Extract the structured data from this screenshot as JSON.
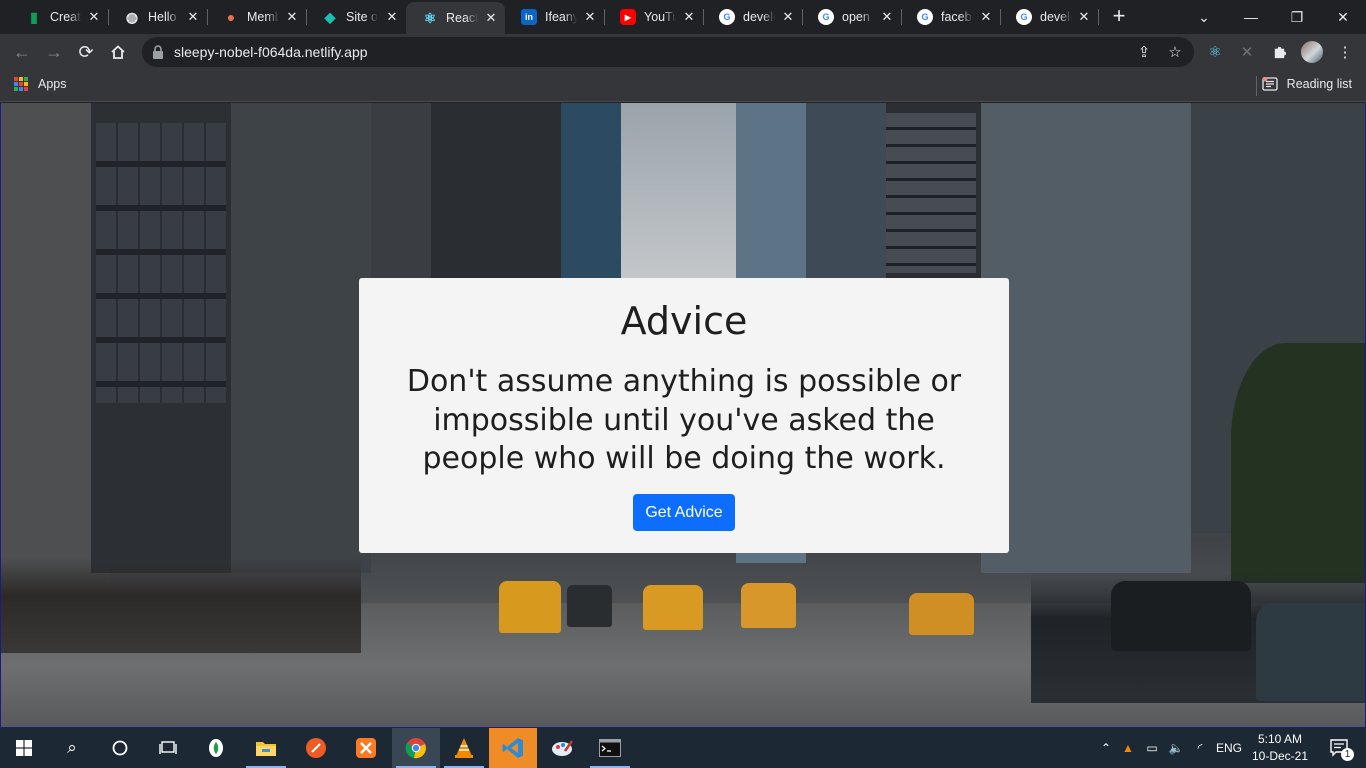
{
  "browser": {
    "tabs": [
      {
        "title": "Creatin",
        "icon": "sheets-icon",
        "color": "#0f9d58"
      },
      {
        "title": "Hello W",
        "icon": "globe-icon",
        "color": "#e8eaed"
      },
      {
        "title": "Memb",
        "icon": "member-icon",
        "color": "#e8744f"
      },
      {
        "title": "Site ov",
        "icon": "netlify-icon",
        "color": "#1bbfb4"
      },
      {
        "title": "React A",
        "icon": "react-icon",
        "color": "#61dafb",
        "active": true
      },
      {
        "title": "Ifeanyi",
        "icon": "linkedin-icon",
        "color": "#0a66c2"
      },
      {
        "title": "YouTub",
        "icon": "youtube-icon",
        "color": "#ff0000"
      },
      {
        "title": "develo",
        "icon": "google-icon",
        "color": "#ffffff"
      },
      {
        "title": "open s",
        "icon": "google-icon",
        "color": "#ffffff"
      },
      {
        "title": "facebo",
        "icon": "google-icon",
        "color": "#ffffff"
      },
      {
        "title": "develo",
        "icon": "google-icon",
        "color": "#ffffff"
      }
    ],
    "url": "sleepy-nobel-f064da.netlify.app",
    "bookmarks": {
      "apps_label": "Apps",
      "reading_list_label": "Reading list"
    }
  },
  "app": {
    "title": "Advice",
    "advice": "Don't assume anything is possible or impossible until you've asked the people who will be doing the work.",
    "button_label": "Get Advice",
    "button_color": "#0d6efd"
  },
  "taskbar": {
    "language": "ENG",
    "time": "5:10 AM",
    "date": "10-Dec-21",
    "notification_count": "1"
  }
}
